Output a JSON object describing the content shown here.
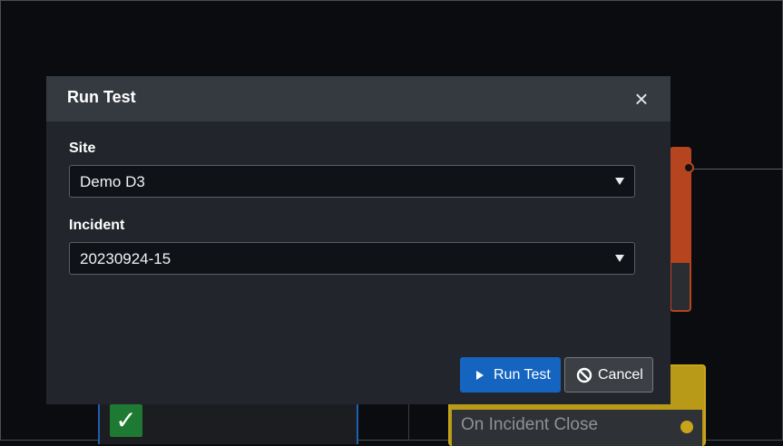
{
  "background": {
    "node_label": "On Incident Close"
  },
  "modal": {
    "title": "Run Test",
    "close_symbol": "×",
    "fields": [
      {
        "label": "Site",
        "value": "Demo D3"
      },
      {
        "label": "Incident",
        "value": "20230924-15"
      }
    ],
    "buttons": {
      "run_label": "Run Test",
      "cancel_label": "Cancel"
    }
  },
  "colors": {
    "primary": "#1565c0",
    "modal_bg": "#22252b",
    "header_bg": "#353a40",
    "node_orange": "#b6441f",
    "node_yellow": "#c8a41b",
    "check_green": "#1e7a33"
  },
  "icons": {
    "close": "close-icon",
    "select_arrow": "caret-down-icon",
    "run": "play-icon",
    "cancel": "ban-icon",
    "check": "checkmark-icon"
  }
}
